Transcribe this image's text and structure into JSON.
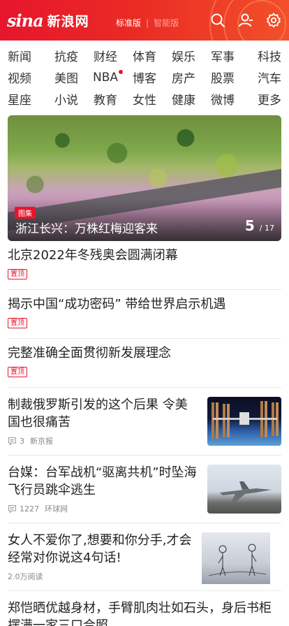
{
  "header": {
    "logo_mark": "sina",
    "logo_name": "新浪网",
    "edition_standard": "标准版",
    "edition_smart": "智能版",
    "icons": [
      "search-icon",
      "user-icon",
      "settings-icon"
    ],
    "brand_color": "#e6162d"
  },
  "nav": {
    "items": [
      "新闻",
      "抗疫",
      "财经",
      "体育",
      "娱乐",
      "军事",
      "科技",
      "视频",
      "美图",
      "NBA",
      "博客",
      "房产",
      "股票",
      "汽车",
      "星座",
      "小说",
      "教育",
      "女性",
      "健康",
      "微博",
      "更多"
    ]
  },
  "hero": {
    "tag": "图集",
    "caption": "浙江长兴：万株红梅迎客来",
    "current": "5",
    "total": "/ 17"
  },
  "pinned": [
    {
      "title": "北京2022年冬残奥会圆满闭幕",
      "badge": "置顶"
    },
    {
      "title": "揭示中国“成功密码” 带给世界启示机遇",
      "badge": "置顶"
    },
    {
      "title": "完整准确全面贯彻新发展理念",
      "badge": "置顶"
    }
  ],
  "stories": [
    {
      "title": "制裁俄罗斯引发的这个后果 令美国也很痛苦",
      "comments": "3",
      "source": "新京报"
    },
    {
      "title": "台媒：台军战机“驱离共机”时坠海飞行员跳伞逃生",
      "comments": "1227",
      "source": "环球网"
    },
    {
      "title": "女人不爱你了,想要和你分手,才会经常对你说这4句话!",
      "reads": "2.0万阅读"
    }
  ],
  "last": {
    "title": "郑恺晒优越身材，手臂肌肉壮如石头，身后书柜摆满一家三口合照"
  }
}
